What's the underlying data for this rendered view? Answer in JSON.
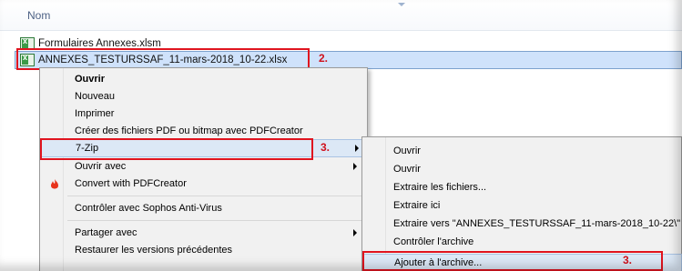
{
  "header": {
    "column_name": "Nom"
  },
  "files": [
    {
      "name": "Formulaires Annexes.xlsm"
    },
    {
      "name": "ANNEXES_TESTURSSAF_11-mars-2018_10-22.xlsx"
    }
  ],
  "steps": {
    "step2": "2.",
    "step3a": "3.",
    "step3b": "3."
  },
  "context_menu": {
    "items": [
      "Ouvrir",
      "Nouveau",
      "Imprimer",
      "Créer des fichiers PDF ou bitmap avec PDFCreator",
      "7-Zip",
      "Ouvrir avec",
      "Convert with PDFCreator",
      "Contrôler avec Sophos Anti-Virus",
      "Partager avec",
      "Restaurer les versions précédentes"
    ]
  },
  "submenu_7zip": {
    "items": [
      "Ouvrir",
      "Ouvrir",
      "Extraire les fichiers...",
      "Extraire ici",
      "Extraire vers \"ANNEXES_TESTURSSAF_11-mars-2018_10-22\\\"",
      "Contrôler l'archive",
      "Ajouter à l'archive..."
    ]
  },
  "colors": {
    "highlight": "#e0141f",
    "selection": "#cfe2fb",
    "hover": "#dce8f6"
  }
}
